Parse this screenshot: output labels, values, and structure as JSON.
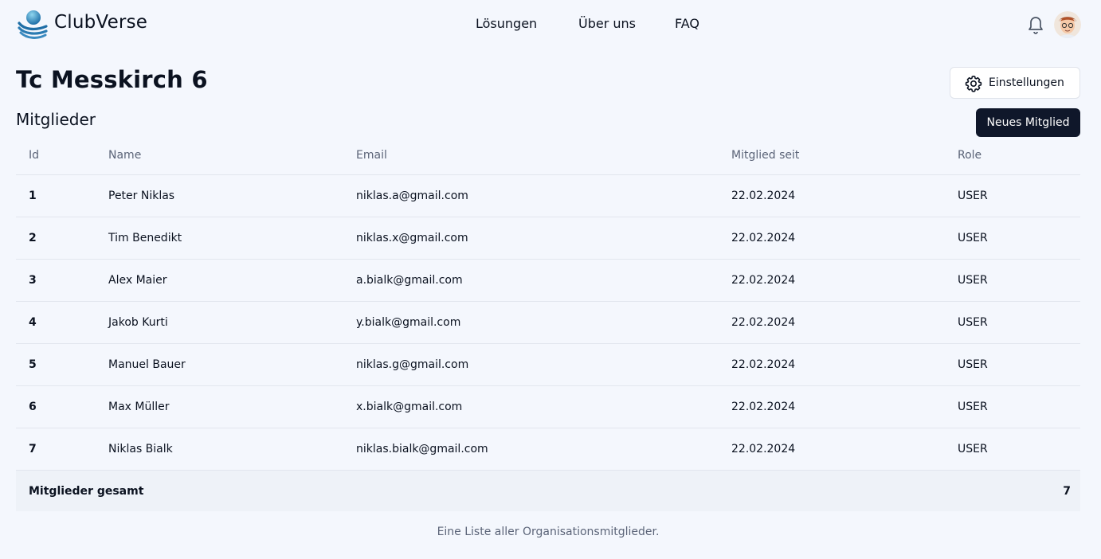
{
  "header": {
    "brand": "ClubVerse",
    "nav": [
      "Lösungen",
      "Über uns",
      "FAQ"
    ],
    "bell_icon": "bell-icon",
    "avatar_icon": "user-avatar"
  },
  "page": {
    "title": "Tc Messkirch 6",
    "settings_label": "Einstellungen",
    "section_title": "Mitglieder",
    "new_member_label": "Neues Mitglied"
  },
  "table": {
    "columns": [
      "Id",
      "Name",
      "Email",
      "Mitglied seit",
      "Role"
    ],
    "rows": [
      [
        "1",
        "Peter Niklas",
        "niklas.a@gmail.com",
        "22.02.2024",
        "USER"
      ],
      [
        "2",
        "Tim Benedikt",
        "niklas.x@gmail.com",
        "22.02.2024",
        "USER"
      ],
      [
        "3",
        "Alex Maier",
        "a.bialk@gmail.com",
        "22.02.2024",
        "USER"
      ],
      [
        "4",
        "Jakob Kurti",
        "y.bialk@gmail.com",
        "22.02.2024",
        "USER"
      ],
      [
        "5",
        "Manuel Bauer",
        "niklas.g@gmail.com",
        "22.02.2024",
        "USER"
      ],
      [
        "6",
        "Max Müller",
        "x.bialk@gmail.com",
        "22.02.2024",
        "USER"
      ],
      [
        "7",
        "Niklas Bialk",
        "niklas.bialk@gmail.com",
        "22.02.2024",
        "USER"
      ]
    ],
    "footer_label": "Mitglieder gesamt",
    "footer_count": "7",
    "caption": "Eine Liste aller Organisationsmitglieder."
  },
  "colors": {
    "background": "#f4f7fd",
    "primary_button": "#0f172a",
    "muted_text": "#5b6478",
    "border": "#e2e6ee"
  }
}
